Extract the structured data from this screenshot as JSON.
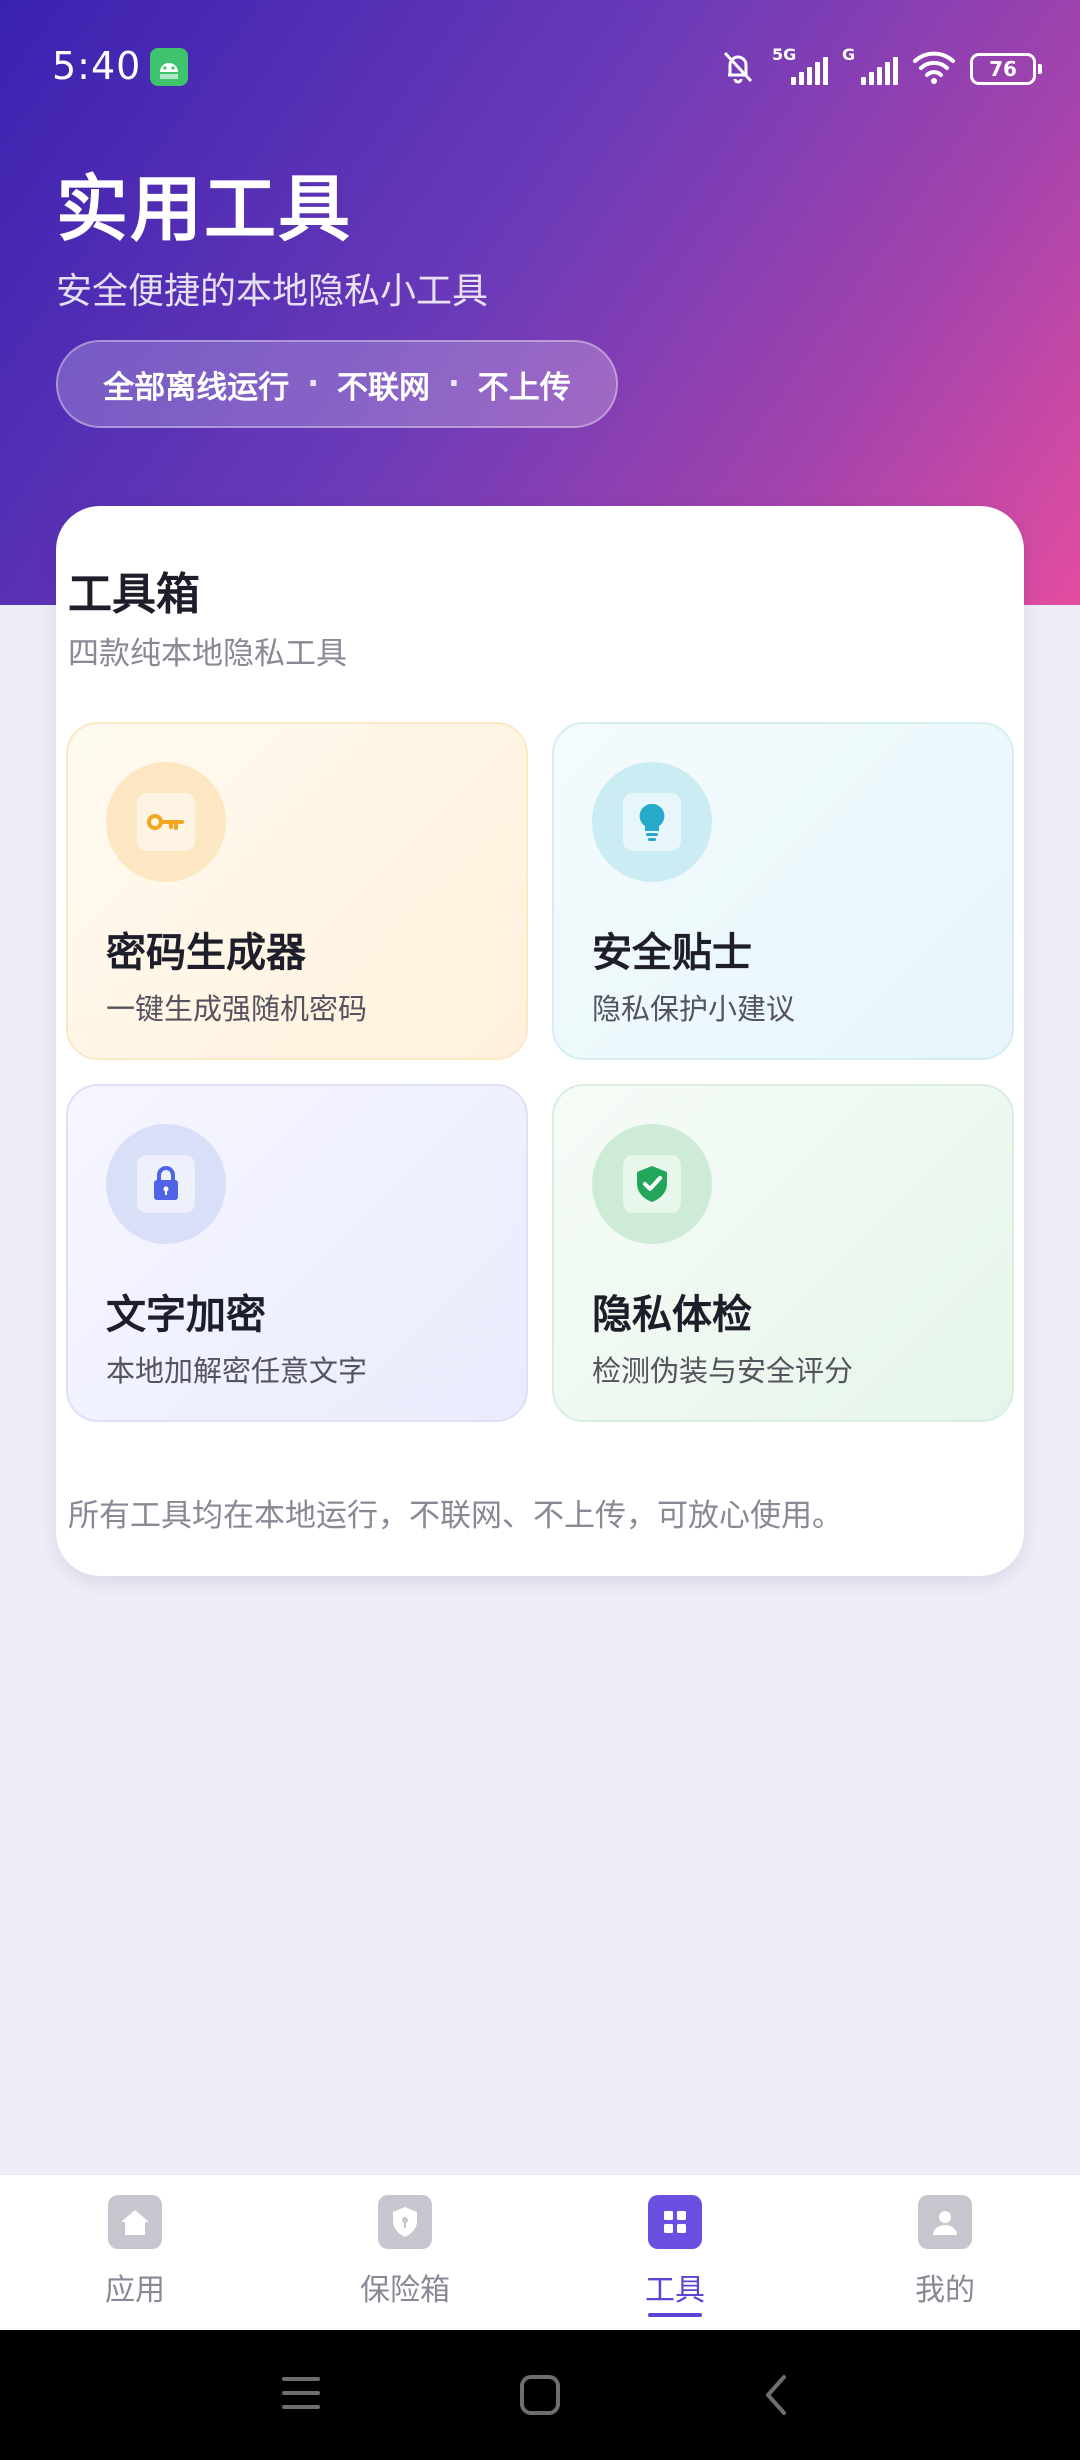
{
  "status_bar": {
    "time": "5:40",
    "network1": "5G",
    "network2": "G",
    "battery": "76"
  },
  "header": {
    "title": "实用工具",
    "subtitle": "安全便捷的本地隐私小工具",
    "pill": [
      "全部离线运行",
      "不联网",
      "不上传"
    ],
    "pill_separator": "·"
  },
  "toolbox": {
    "title": "工具箱",
    "subtitle": "四款纯本地隐私工具",
    "tools": [
      {
        "title": "密码生成器",
        "desc": "一键生成强随机密码",
        "icon": "key-icon",
        "accent": "#f2a71f"
      },
      {
        "title": "安全贴士",
        "desc": "隐私保护小建议",
        "icon": "lightbulb-icon",
        "accent": "#27a9c9"
      },
      {
        "title": "文字加密",
        "desc": "本地加解密任意文字",
        "icon": "lock-icon",
        "accent": "#4f63e6"
      },
      {
        "title": "隐私体检",
        "desc": "检测伪装与安全评分",
        "icon": "shield-check-icon",
        "accent": "#22a75a"
      }
    ],
    "footer": "所有工具均在本地运行，不联网、不上传，可放心使用。"
  },
  "tabbar": {
    "items": [
      {
        "label": "应用",
        "icon": "home-icon",
        "active": false
      },
      {
        "label": "保险箱",
        "icon": "shield-icon",
        "active": false
      },
      {
        "label": "工具",
        "icon": "grid-icon",
        "active": true
      },
      {
        "label": "我的",
        "icon": "person-icon",
        "active": false
      }
    ]
  },
  "colors": {
    "hero_gradient": [
      "#3a21b0",
      "#6a3ab8",
      "#a243ad",
      "#e34da0"
    ],
    "accent": "#6a4fe0",
    "background": "#efeef6"
  }
}
